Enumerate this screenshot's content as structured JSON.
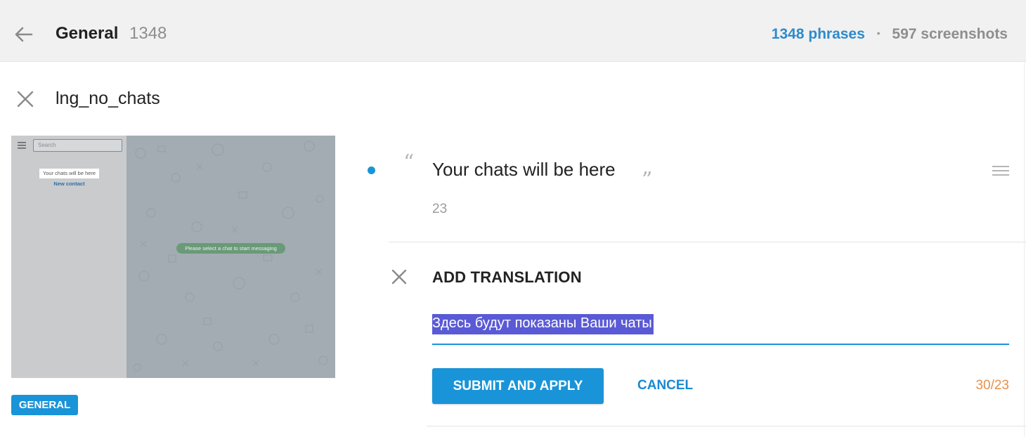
{
  "header": {
    "title": "General",
    "count": "1348",
    "phrases_label": "1348 phrases",
    "separator": "•",
    "screenshots_label": "597 screenshots"
  },
  "key": {
    "name": "lng_no_chats"
  },
  "screenshot": {
    "search_placeholder": "Search",
    "empty_text": "Your chats will be here",
    "new_contact": "New contact",
    "center_pill": "Please select a chat to start messaging"
  },
  "tag": {
    "label": "GENERAL"
  },
  "phrase": {
    "text": "Your chats will be here",
    "quote_open": "“",
    "quote_close": "”",
    "length": "23"
  },
  "translation": {
    "title": "ADD TRANSLATION",
    "value": "Здесь будут показаны Ваши чаты",
    "submit_label": "SUBMIT AND APPLY",
    "cancel_label": "CANCEL",
    "counter": "30/23"
  },
  "colors": {
    "accent": "#1a94d8",
    "counter_warning": "#e8904a",
    "selection": "#5a5ad6"
  },
  "icons": {
    "back": "arrow-left-icon",
    "close": "close-icon",
    "menu": "menu-icon"
  }
}
